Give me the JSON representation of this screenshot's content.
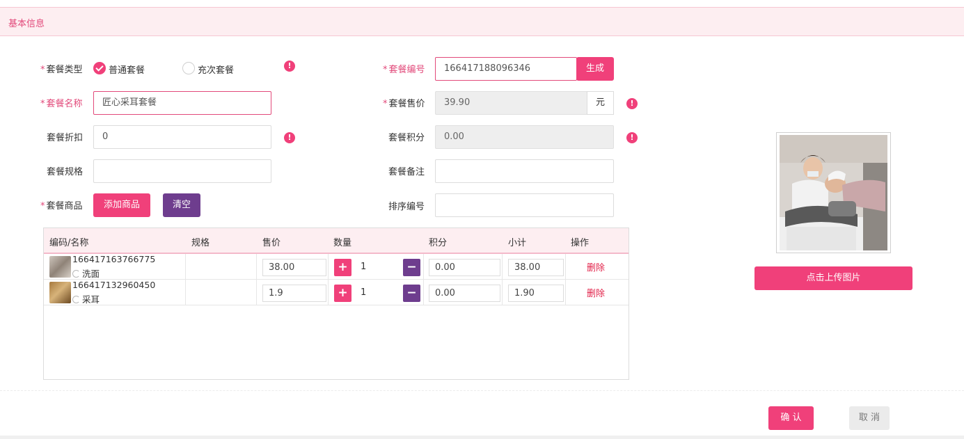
{
  "section": {
    "title": "基本信息"
  },
  "form": {
    "package_type": {
      "label": "套餐类型",
      "options": [
        "普通套餐",
        "充次套餐"
      ],
      "selected": "普通套餐"
    },
    "package_no": {
      "label": "套餐编号",
      "value": "166417188096346",
      "generate_label": "生成"
    },
    "package_name": {
      "label": "套餐名称",
      "value": "匠心采耳套餐"
    },
    "sale_price": {
      "label": "套餐售价",
      "value": "39.90",
      "unit": "元"
    },
    "discount": {
      "label": "套餐折扣",
      "value": "0"
    },
    "points": {
      "label": "套餐积分",
      "value": "0.00"
    },
    "spec": {
      "label": "套餐规格",
      "value": ""
    },
    "remark": {
      "label": "套餐备注",
      "value": ""
    },
    "goods": {
      "label": "套餐商品",
      "add_label": "添加商品",
      "clear_label": "清空"
    },
    "sort_no": {
      "label": "排序编号",
      "value": ""
    },
    "warn_icon": "!"
  },
  "table": {
    "headers": [
      "编码/名称",
      "规格",
      "售价",
      "数量",
      "积分",
      "小计",
      "操作"
    ],
    "rows": [
      {
        "code": "166417163766775",
        "name": "洗面",
        "spec": "",
        "price": "38.00",
        "qty": "1",
        "points": "0.00",
        "subtotal": "38.00",
        "action": "删除"
      },
      {
        "code": "166417132960450",
        "name": "采耳",
        "spec": "",
        "price": "1.9",
        "qty": "1",
        "points": "0.00",
        "subtotal": "1.90",
        "action": "删除"
      }
    ],
    "plus": "+",
    "minus": "−"
  },
  "upload": {
    "label": "点击上传图片"
  },
  "footer": {
    "confirm": "确 认",
    "cancel": "取 消"
  },
  "colors": {
    "accent": "#f0407a",
    "purple": "#6e3d8e",
    "header_bg": "#fdeef1"
  }
}
